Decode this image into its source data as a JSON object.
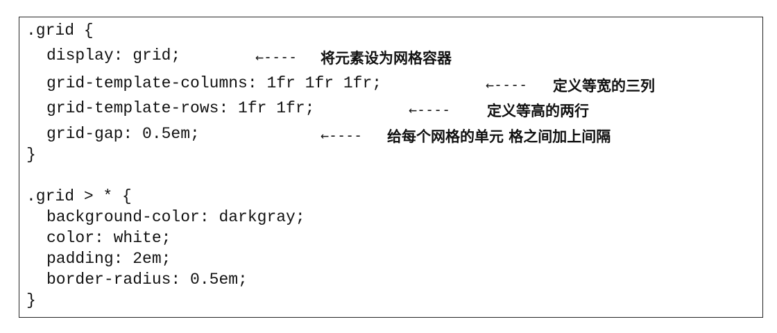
{
  "rules": [
    {
      "selector": ".grid {",
      "declarations": [
        {
          "code": "display: grid;",
          "arrow": "←----",
          "note": "将元素设为网格容器"
        },
        {
          "code": "grid-template-columns: 1fr 1fr 1fr;",
          "arrow": "←----",
          "note": "定义等宽的三列"
        },
        {
          "code": "grid-template-rows: 1fr 1fr;",
          "arrow": "←----",
          "note": "定义等高的两行"
        },
        {
          "code": "grid-gap: 0.5em;",
          "arrow": "←----",
          "note": "给每个网格的单元 格之间加上间隔"
        }
      ],
      "close": "}"
    },
    {
      "selector": ".grid > * {",
      "declarations": [
        {
          "code": "background-color: darkgray;"
        },
        {
          "code": "color: white;"
        },
        {
          "code": "padding: 2em;"
        },
        {
          "code": "border-radius: 0.5em;"
        }
      ],
      "close": "}"
    }
  ]
}
